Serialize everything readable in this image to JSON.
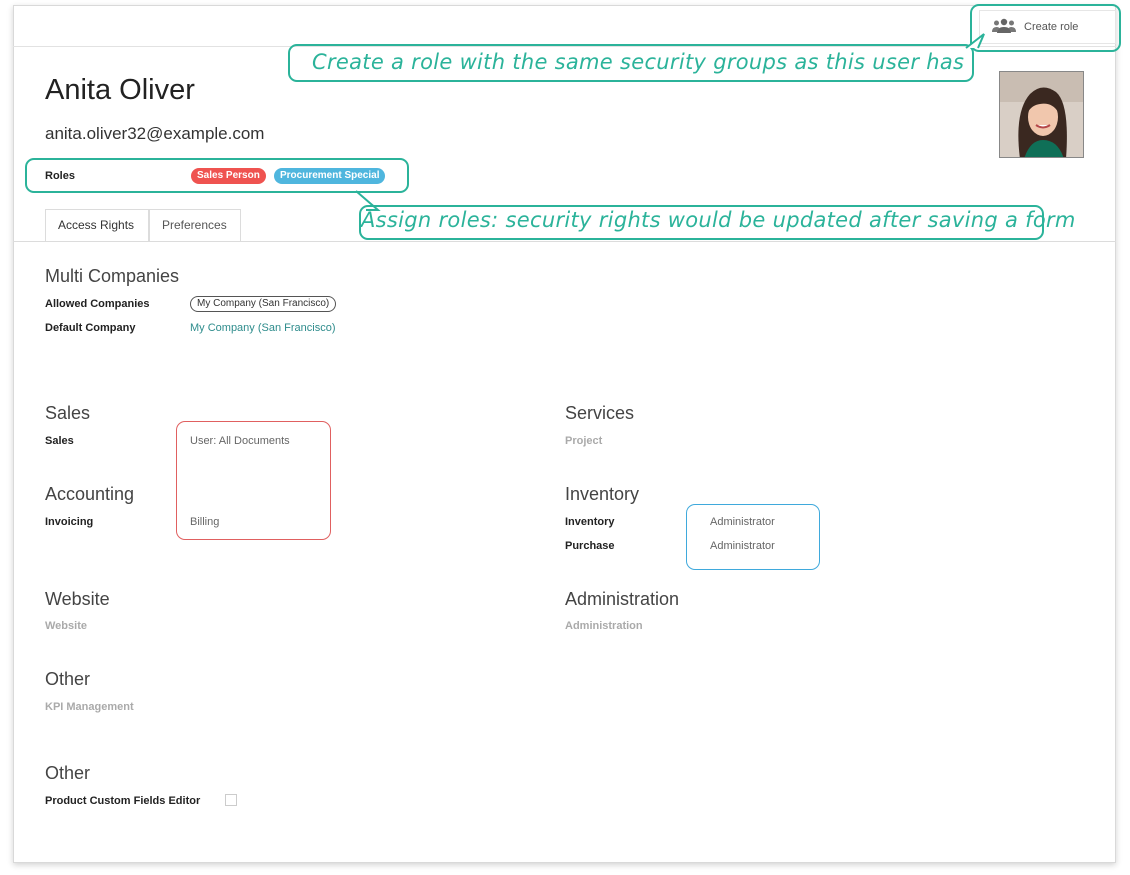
{
  "toolbar": {
    "create_role_label": "Create role",
    "create_role_icon": "users-icon"
  },
  "callouts": {
    "create_role": "Create a role with the same security groups as this user has",
    "assign_roles": "Assign roles: security rights would be updated after saving a form",
    "color": "#2bb39a"
  },
  "user": {
    "name": "Anita Oliver",
    "email": "anita.oliver32@example.com"
  },
  "roles": {
    "label": "Roles",
    "tags": [
      {
        "label": "Sales Person",
        "color": "#ef5350"
      },
      {
        "label": "Procurement Special",
        "color": "#4fb6de"
      }
    ]
  },
  "tabs": [
    {
      "label": "Access Rights",
      "active": true
    },
    {
      "label": "Preferences",
      "active": false
    }
  ],
  "multi_companies": {
    "title": "Multi Companies",
    "allowed_label": "Allowed Companies",
    "allowed_value": "My Company (San Francisco)",
    "default_label": "Default Company",
    "default_value": "My Company (San Francisco)"
  },
  "sales": {
    "title": "Sales",
    "field_label": "Sales",
    "field_value": "User: All Documents"
  },
  "accounting": {
    "title": "Accounting",
    "field_label": "Invoicing",
    "field_value": "Billing"
  },
  "services": {
    "title": "Services",
    "field_label": "Project"
  },
  "inventory": {
    "title": "Inventory",
    "rows": [
      {
        "label": "Inventory",
        "value": "Administrator"
      },
      {
        "label": "Purchase",
        "value": "Administrator"
      }
    ]
  },
  "website": {
    "title": "Website",
    "field_label": "Website"
  },
  "administration": {
    "title": "Administration",
    "field_label": "Administration"
  },
  "other1": {
    "title": "Other",
    "field_label": "KPI Management"
  },
  "other2": {
    "title": "Other",
    "field_label": "Product Custom Fields Editor",
    "checked": false
  },
  "highlight_colors": {
    "red": "#e06060",
    "blue": "#3fa9dc"
  }
}
